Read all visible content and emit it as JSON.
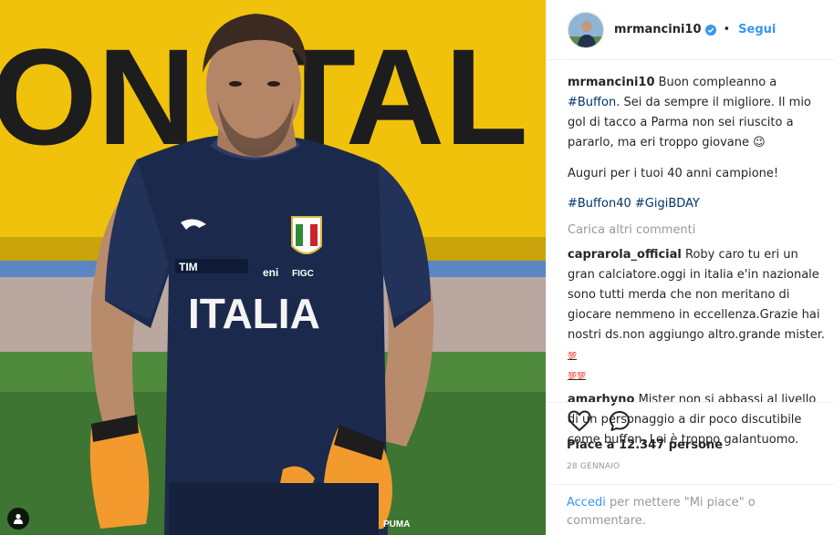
{
  "post": {
    "username": "mrmancini10",
    "follow_label": "Segui",
    "separator": "•"
  },
  "caption": {
    "username": "mrmancini10",
    "text_before": "Buon compleanno a ",
    "mention": "#Buffon",
    "text_after": ". Sei da sempre il migliore. Il mio gol di tacco a Parma non sei riuscito a pararlo, ma eri troppo giovane 😉",
    "paragraph2": "Auguri per i tuoi 40 anni campione!",
    "tag1": "#Buffon40",
    "tag2": "#GigiBDAY"
  },
  "load_more": "Carica altri commenti",
  "comments": [
    {
      "username": "caprarola_official",
      "text": "Roby caro tu eri un gran calciatore.oggi in italia e'in nazionale sono tutti merda che non meritano di giocare nemmeno in eccellenza.Grazie hai nostri ds.non aggiungo altro.grande mister.",
      "emoji1": "💯",
      "emoji2": "💯💯"
    },
    {
      "username": "amarhyno",
      "text": "Mister non si abbassi al livello di un personaggio a dir poco discutibile come buffon. Lei è troppo galantuomo."
    }
  ],
  "likes_text": "Piace a 12.347 persone",
  "date_text": "28 GENNAIO",
  "login": {
    "link": "Accedi",
    "rest": " per mettere \"Mi piace\" o commentare."
  },
  "photo": {
    "banner_text": "ON ITAL",
    "shirt_text": "ITALIA",
    "sponsor1": "TIM",
    "sponsor2": "eni",
    "sponsor3": "FIGC",
    "brand": "PUMA"
  },
  "colors": {
    "link_blue": "#3897f0",
    "hashtag": "#003569",
    "muted": "#999999",
    "shirt": "#1c2a4a",
    "banner": "#f3c400"
  },
  "icons": [
    "heart-icon",
    "comment-icon",
    "verified-icon",
    "user-tag-icon"
  ]
}
